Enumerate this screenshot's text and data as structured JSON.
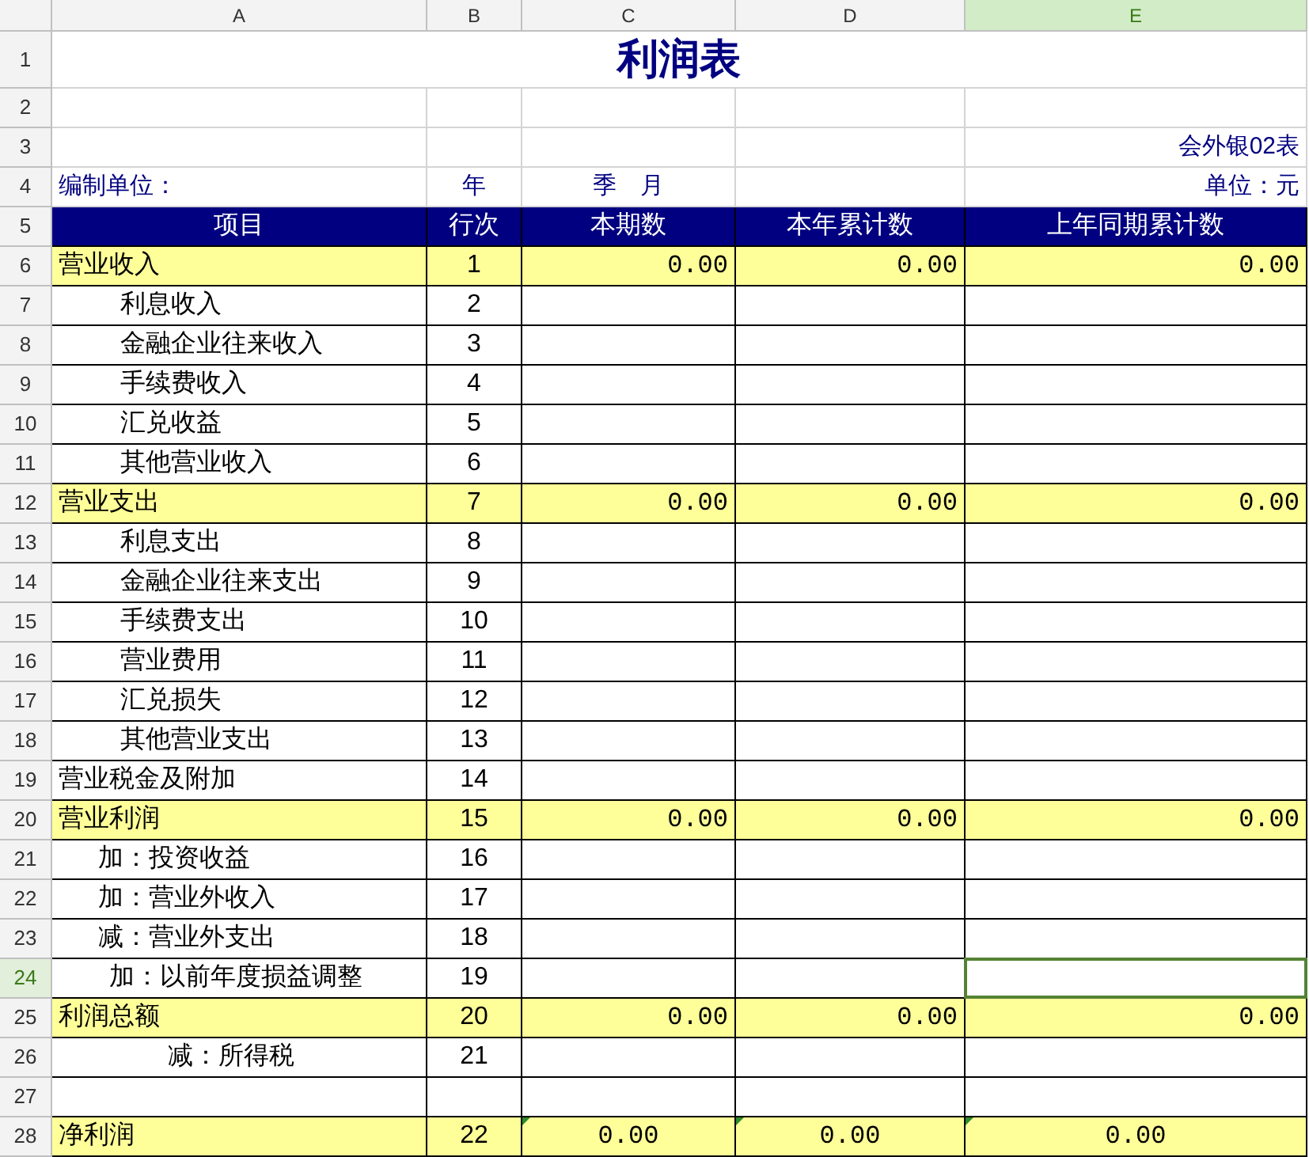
{
  "columns": [
    {
      "label": "A",
      "selected": false
    },
    {
      "label": "B",
      "selected": false
    },
    {
      "label": "C",
      "selected": false
    },
    {
      "label": "D",
      "selected": false
    },
    {
      "label": "E",
      "selected": true
    }
  ],
  "title": {
    "row": "1",
    "text": "利润表"
  },
  "blank_rows": [
    {
      "row": "2",
      "selected": false
    }
  ],
  "form_code": {
    "row": "3",
    "text": "会外银02表"
  },
  "info_row": {
    "row": "4",
    "unit_label": "编制单位：",
    "year": "年",
    "period": "季　月",
    "currency": "单位：元"
  },
  "header_row": {
    "row": "5",
    "cells": [
      "项目",
      "行次",
      "本期数",
      "本年累计数",
      "上年同期累计数"
    ]
  },
  "rows": [
    {
      "row": "6",
      "kind": "group",
      "highlighted": true,
      "flagged": false,
      "selected": false,
      "label": "营业收入",
      "line": "1",
      "values": [
        "0.00",
        "0.00",
        "0.00"
      ]
    },
    {
      "row": "7",
      "kind": "item",
      "highlighted": false,
      "flagged": false,
      "selected": false,
      "label": "利息收入",
      "line": "2",
      "values": []
    },
    {
      "row": "8",
      "kind": "item",
      "highlighted": false,
      "flagged": false,
      "selected": false,
      "label": "金融企业往来收入",
      "line": "3",
      "values": []
    },
    {
      "row": "9",
      "kind": "item",
      "highlighted": false,
      "flagged": false,
      "selected": false,
      "label": "手续费收入",
      "line": "4",
      "values": []
    },
    {
      "row": "10",
      "kind": "item",
      "highlighted": false,
      "flagged": false,
      "selected": false,
      "label": "汇兑收益",
      "line": "5",
      "values": []
    },
    {
      "row": "11",
      "kind": "item",
      "highlighted": false,
      "flagged": false,
      "selected": false,
      "label": "其他营业收入",
      "line": "6",
      "values": []
    },
    {
      "row": "12",
      "kind": "group",
      "highlighted": true,
      "flagged": false,
      "selected": false,
      "label": "营业支出",
      "line": "7",
      "values": [
        "0.00",
        "0.00",
        "0.00"
      ]
    },
    {
      "row": "13",
      "kind": "item",
      "highlighted": false,
      "flagged": false,
      "selected": false,
      "label": "利息支出",
      "line": "8",
      "values": []
    },
    {
      "row": "14",
      "kind": "item",
      "highlighted": false,
      "flagged": false,
      "selected": false,
      "label": "金融企业往来支出",
      "line": "9",
      "values": []
    },
    {
      "row": "15",
      "kind": "item",
      "highlighted": false,
      "flagged": false,
      "selected": false,
      "label": "手续费支出",
      "line": "10",
      "values": []
    },
    {
      "row": "16",
      "kind": "item",
      "highlighted": false,
      "flagged": false,
      "selected": false,
      "label": "营业费用",
      "line": "11",
      "values": []
    },
    {
      "row": "17",
      "kind": "item",
      "highlighted": false,
      "flagged": false,
      "selected": false,
      "label": "汇兑损失",
      "line": "12",
      "values": []
    },
    {
      "row": "18",
      "kind": "item",
      "highlighted": false,
      "flagged": false,
      "selected": false,
      "label": "其他营业支出",
      "line": "13",
      "values": []
    },
    {
      "row": "19",
      "kind": "group",
      "highlighted": false,
      "flagged": false,
      "selected": false,
      "label": "营业税金及附加",
      "line": "14",
      "values": []
    },
    {
      "row": "20",
      "kind": "group",
      "highlighted": true,
      "flagged": false,
      "selected": false,
      "label": "营业利润",
      "line": "15",
      "values": [
        "0.00",
        "0.00",
        "0.00"
      ]
    },
    {
      "row": "21",
      "kind": "adjust",
      "highlighted": false,
      "flagged": false,
      "selected": false,
      "label": "加：投资收益",
      "line": "16",
      "values": []
    },
    {
      "row": "22",
      "kind": "adjust",
      "highlighted": false,
      "flagged": false,
      "selected": false,
      "label": "加：营业外收入",
      "line": "17",
      "values": []
    },
    {
      "row": "23",
      "kind": "adjust",
      "highlighted": false,
      "flagged": false,
      "selected": false,
      "label": "减：营业外支出",
      "line": "18",
      "values": []
    },
    {
      "row": "24",
      "kind": "adjust_wide",
      "highlighted": false,
      "flagged": false,
      "selected": true,
      "label": "加：以前年度损益调整",
      "line": "19",
      "values": []
    },
    {
      "row": "25",
      "kind": "group",
      "highlighted": true,
      "flagged": false,
      "selected": false,
      "label": "利润总额",
      "line": "20",
      "values": [
        "0.00",
        "0.00",
        "0.00"
      ]
    },
    {
      "row": "26",
      "kind": "tax",
      "highlighted": false,
      "flagged": false,
      "selected": false,
      "label": "减：所得税",
      "line": "21",
      "values": []
    },
    {
      "row": "27",
      "kind": "empty",
      "highlighted": false,
      "flagged": false,
      "selected": false,
      "values": []
    },
    {
      "row": "28",
      "kind": "net",
      "highlighted": true,
      "flagged": true,
      "selected": false,
      "label": "净利润",
      "line": "22",
      "values": [
        "0.00",
        "0.00",
        "0.00"
      ]
    }
  ]
}
